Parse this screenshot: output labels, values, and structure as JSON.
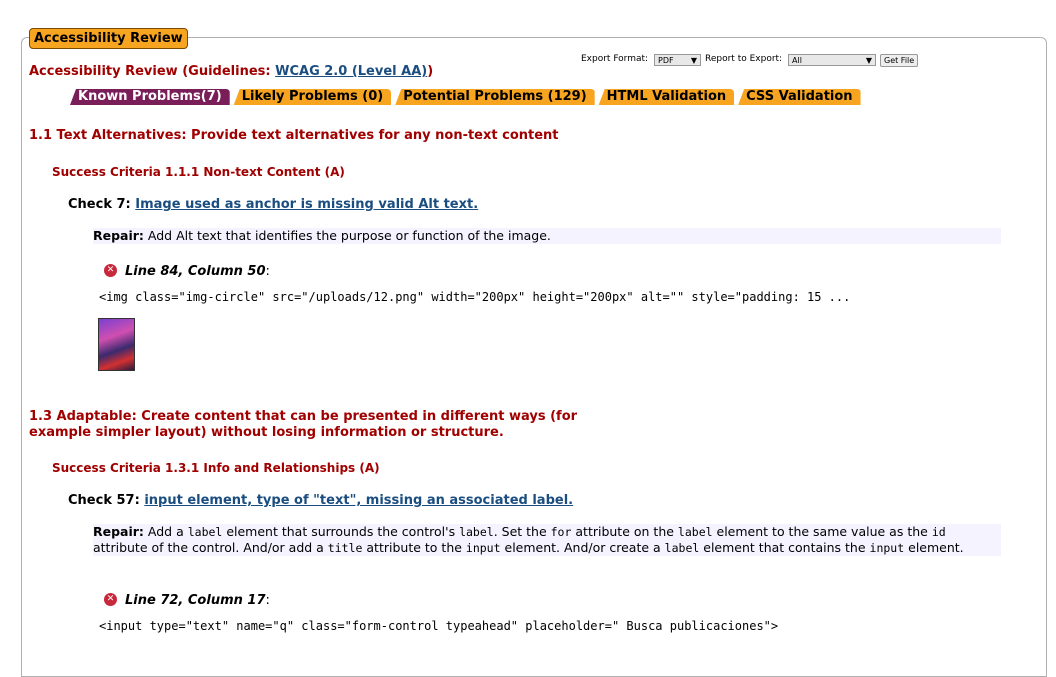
{
  "legend": "Accessibility Review",
  "review": {
    "prefix": "Accessibility Review (Guidelines: ",
    "guideline_link": "WCAG 2.0 (Level AA)",
    "suffix": ")"
  },
  "export": {
    "format_label": "Export Format:",
    "format_value": "PDF",
    "report_label": "Report to Export:",
    "report_value": "All",
    "button": "Get File"
  },
  "tabs": [
    {
      "label": "Known Problems(7)"
    },
    {
      "label": "Likely Problems (0)"
    },
    {
      "label": "Potential Problems (129)"
    },
    {
      "label": "HTML Validation"
    },
    {
      "label": "CSS Validation"
    }
  ],
  "section1": {
    "heading": "1.1 Text Alternatives: Provide text alternatives for any non-text content",
    "criteria": "Success Criteria 1.1.1 Non-text Content (A)",
    "check_prefix": "Check 7:",
    "check_link": "Image used as anchor is missing valid Alt text.",
    "repair_label": "Repair:",
    "repair_text": " Add Alt text that identifies the purpose or function of the image.",
    "line": "Line 84, Column 50",
    "code": "<img class=\"img-circle\" src=\"/uploads/12.png\" width=\"200px\" height=\"200px\" alt=\"\" style=\"padding: 15 ..."
  },
  "section2": {
    "heading_line1": "1.3 Adaptable: Create content that can be presented in different ways (for",
    "heading_line2": "example simpler layout) without losing information or structure.",
    "criteria": "Success Criteria 1.3.1 Info and Relationships (A)",
    "check_prefix": "Check 57:",
    "check_link": "input element, type of \"text\", missing an associated label.",
    "repair_label": "Repair:",
    "repair_parts": [
      " Add a ",
      "label",
      " element that surrounds the control's ",
      "label",
      ". Set the ",
      "for",
      " attribute on the ",
      "label",
      " element to the same value as the ",
      "id",
      " attribute of the control. And/or add a ",
      "title",
      " attribute to the ",
      "input",
      " element. And/or create a ",
      "label",
      " element that contains the ",
      "input",
      " element."
    ],
    "line": "Line 72, Column 17",
    "code": "<input type=\"text\" name=\"q\" class=\"form-control typeahead\" placeholder=\" Busca publicaciones\">"
  },
  "colon": ":",
  "error_icon": "x-circle-icon"
}
